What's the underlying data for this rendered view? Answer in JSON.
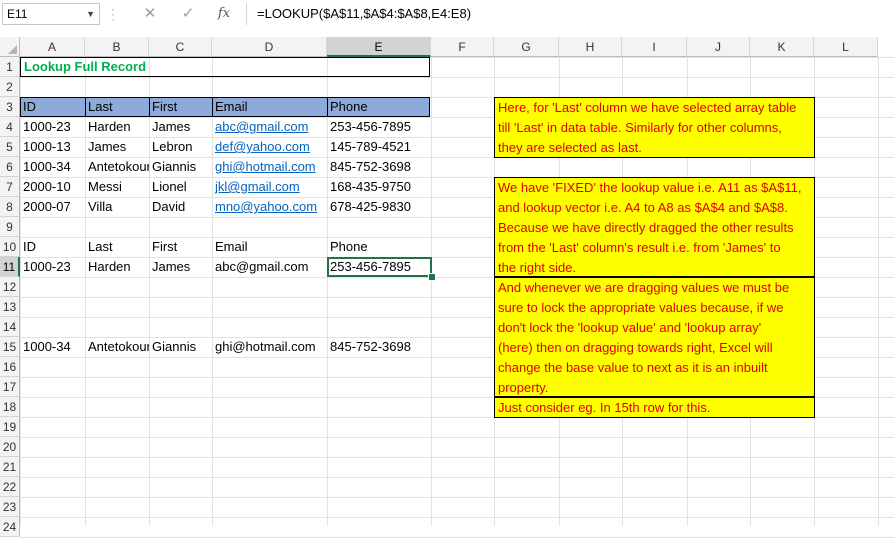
{
  "formula_bar": {
    "name_box": "E11",
    "cancel_icon": "✕",
    "enter_icon": "✓",
    "fx_label": "fx",
    "formula": "=LOOKUP($A$11,$A$4:$A$8,E4:E8)"
  },
  "columns": [
    "A",
    "B",
    "C",
    "D",
    "E",
    "F",
    "G",
    "H",
    "I",
    "J",
    "K",
    "L"
  ],
  "rows": [
    "1",
    "2",
    "3",
    "4",
    "5",
    "6",
    "7",
    "8",
    "9",
    "10",
    "11",
    "12",
    "13",
    "14",
    "15",
    "16",
    "17",
    "18",
    "19",
    "20",
    "21",
    "22",
    "23",
    "24"
  ],
  "sheet": {
    "title": "Lookup Full Record",
    "table_header": [
      "ID",
      "Last",
      "First",
      "Email",
      "Phone"
    ],
    "table_rows": [
      [
        "1000-23",
        "Harden",
        "James",
        "abc@gmail.com",
        "253-456-7895"
      ],
      [
        "1000-13",
        "James",
        "Lebron",
        "def@yahoo.com",
        "145-789-4521"
      ],
      [
        "1000-34",
        "Antetokoun",
        "Giannis",
        "ghi@hotmail.com",
        "845-752-3698"
      ],
      [
        "2000-10",
        "Messi",
        "Lionel",
        "jkl@gmail.com",
        "168-435-9750"
      ],
      [
        "2000-07",
        "Villa",
        "David",
        "mno@yahoo.com",
        "678-425-9830"
      ]
    ],
    "result_header": [
      "ID",
      "Last",
      "First",
      "Email",
      "Phone"
    ],
    "result_row_11": [
      "1000-23",
      "Harden",
      "James",
      "abc@gmail.com",
      "253-456-7895"
    ],
    "result_row_15": [
      "1000-34",
      "Antetokoun",
      "Giannis",
      "ghi@hotmail.com",
      "845-752-3698"
    ]
  },
  "notes": {
    "note1": [
      "Here, for 'Last' column we have selected array table",
      "till 'Last' in data table. Similarly for other columns,",
      "they are selected as last."
    ],
    "note2": [
      "We have 'FIXED' the lookup value i.e. A11 as $A$11,",
      "and lookup vector i.e. A4 to A8 as $A$4 and $A$8.",
      "Because we have directly dragged the other results",
      "from the 'Last' column's result i.e. from 'James' to",
      "the right side."
    ],
    "note3": [
      "And whenever we are dragging values we must  be",
      "sure to lock the appropriate values because, if we",
      "don't lock the 'lookup value' and 'lookup array'",
      "(here) then on dragging towards right, Excel will",
      "change the base value to next as it is an inbuilt",
      "property."
    ],
    "note4": [
      "Just consider eg. In 15th row for this."
    ]
  },
  "colors": {
    "header_band": "#8eaadb",
    "title_green": "#00b050",
    "note_fill": "#ffff00",
    "note_text": "#e00000",
    "selection": "#217346",
    "link": "#0563c1"
  }
}
